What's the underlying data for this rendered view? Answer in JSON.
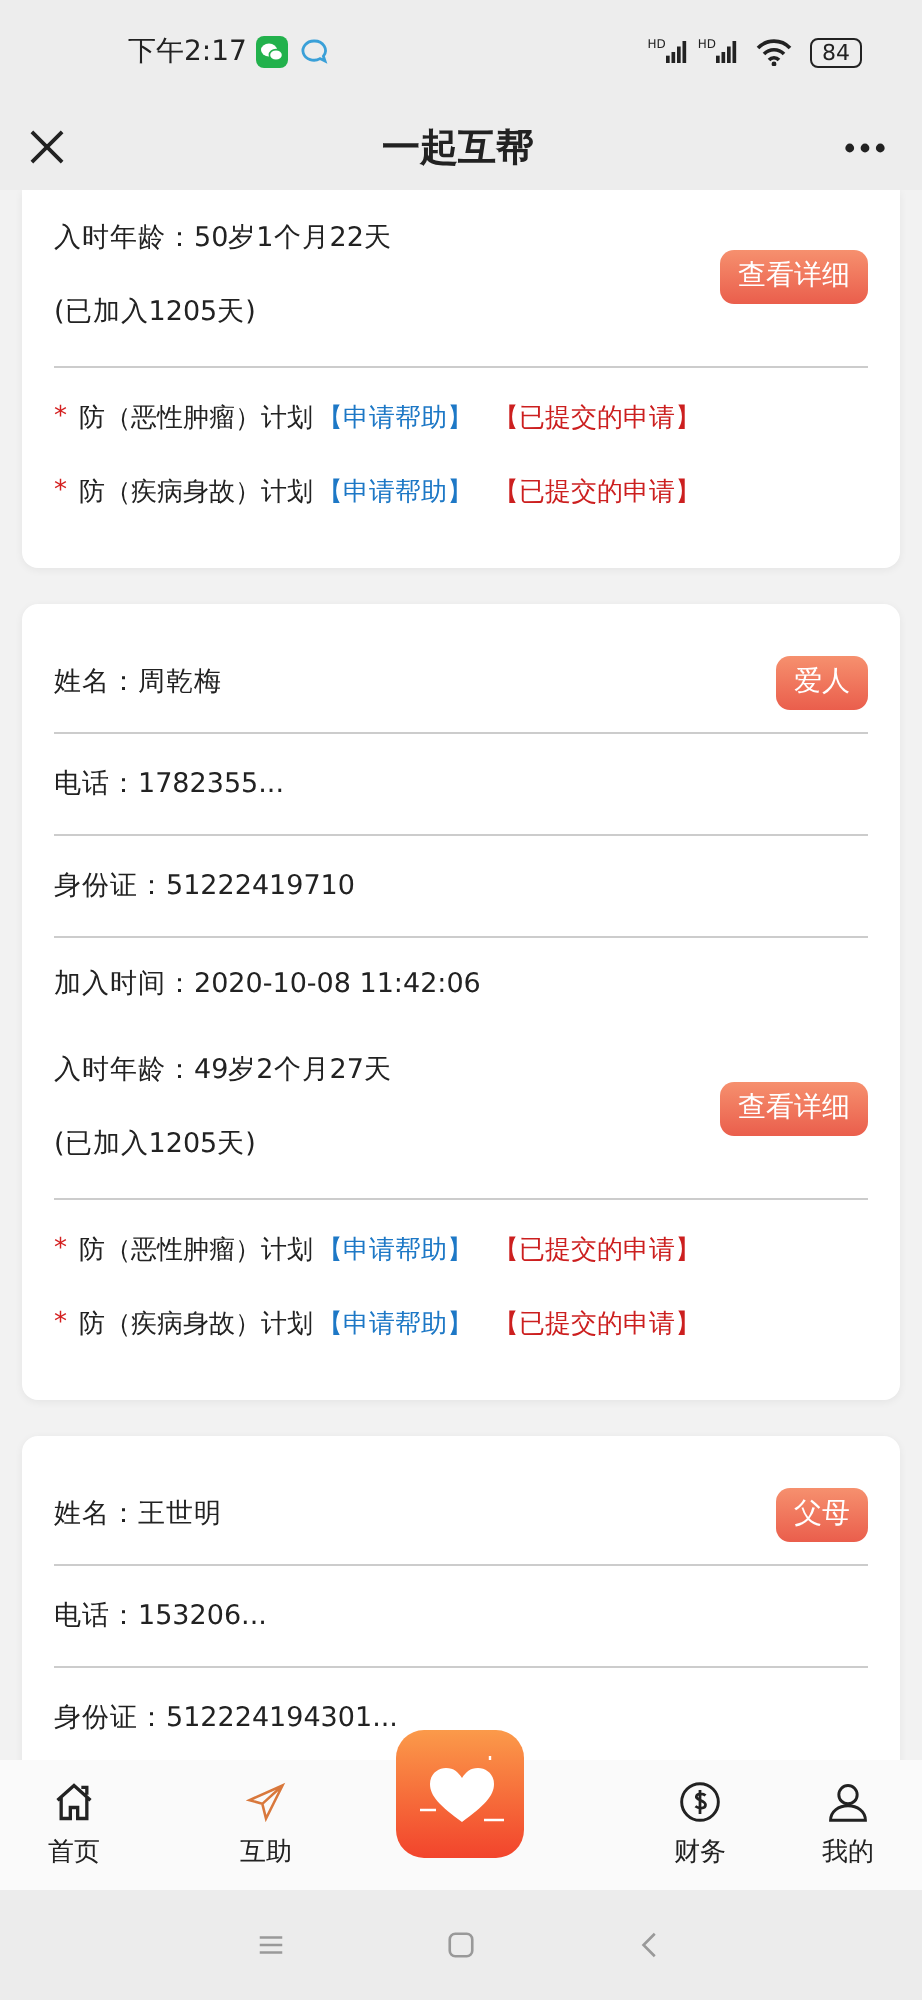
{
  "status_bar": {
    "time": "下午2:17",
    "signals": [
      "HD",
      "HD"
    ],
    "battery": "84"
  },
  "nav": {
    "title": "一起互帮"
  },
  "cards": [
    {
      "age": "入时年龄：50岁1个月22天",
      "joined": "(已加入1205天)",
      "detail_button": "查看详细",
      "plans": [
        {
          "mark": "*",
          "name": "防（恶性肿瘤）计划",
          "apply": "【申请帮助】",
          "submitted": "【已提交的申请】"
        },
        {
          "mark": "*",
          "name": "防（疾病身故）计划",
          "apply": "【申请帮助】",
          "submitted": "【已提交的申请】"
        }
      ]
    },
    {
      "fields": [
        {
          "text": "姓名：周乾梅",
          "tag": "爱人"
        },
        {
          "text": "电话：1782355..."
        },
        {
          "text": "身份证：51222419710"
        },
        {
          "text": "加入时间：2020-10-08 11:42:06"
        }
      ],
      "age": "入时年龄：49岁2个月27天",
      "joined": "(已加入1205天)",
      "detail_button": "查看详细",
      "plans": [
        {
          "mark": "*",
          "name": "防（恶性肿瘤）计划",
          "apply": "【申请帮助】",
          "submitted": "【已提交的申请】"
        },
        {
          "mark": "*",
          "name": "防（疾病身故）计划",
          "apply": "【申请帮助】",
          "submitted": "【已提交的申请】"
        }
      ]
    },
    {
      "fields": [
        {
          "text": "姓名：王世明",
          "tag": "父母"
        },
        {
          "text": "电话：153206..."
        },
        {
          "text": "身份证：512224194301..."
        }
      ]
    }
  ],
  "tabs": [
    {
      "label": "首页",
      "selected": false
    },
    {
      "label": "互助",
      "selected": true
    },
    {
      "label": "财务",
      "selected": false
    },
    {
      "label": "我的",
      "selected": false
    }
  ]
}
